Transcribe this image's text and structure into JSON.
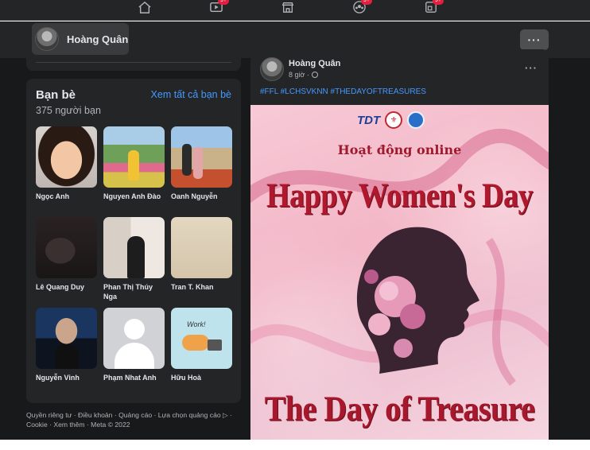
{
  "nav": {
    "icons": [
      {
        "name": "home-icon"
      },
      {
        "name": "watch-icon",
        "badge": "9+"
      },
      {
        "name": "marketplace-icon"
      },
      {
        "name": "groups-icon",
        "badge": "9+"
      },
      {
        "name": "gaming-icon",
        "badge": "9+"
      }
    ]
  },
  "profile_bar": {
    "name": "Hoàng Quân",
    "more_label": "···"
  },
  "friends": {
    "title": "Bạn bè",
    "count": "375 người bạn",
    "see_all": "Xem tất cả bạn bè",
    "items": [
      {
        "name": "Ngọc Anh"
      },
      {
        "name": "Nguyen Anh Đào"
      },
      {
        "name": "Oanh Nguyễn"
      },
      {
        "name": "Lê Quang Duy"
      },
      {
        "name": "Phan Thị Thúy Nga"
      },
      {
        "name": "Tran T. Khan"
      },
      {
        "name": "Nguyễn Vinh"
      },
      {
        "name": "Phạm Nhat Anh"
      },
      {
        "name": "Hữu Hoà"
      }
    ]
  },
  "footer": {
    "text": "Quyền riêng tư · Điều khoản · Quảng cáo · Lựa chọn quảng cáo ▷ · Cookie · Xem thêm · Meta © 2022"
  },
  "post": {
    "author": "Hoàng Quân",
    "time": "8 giờ ·",
    "more_label": "···",
    "hashtags": "#FFL #LCHSVKNN #THEDAYOFTREASURES",
    "poster": {
      "logo_text": "TDT",
      "subtitle": "Hoạt động online",
      "headline": "Happy Women's Day",
      "tagline": "The Day of Treasure"
    }
  }
}
